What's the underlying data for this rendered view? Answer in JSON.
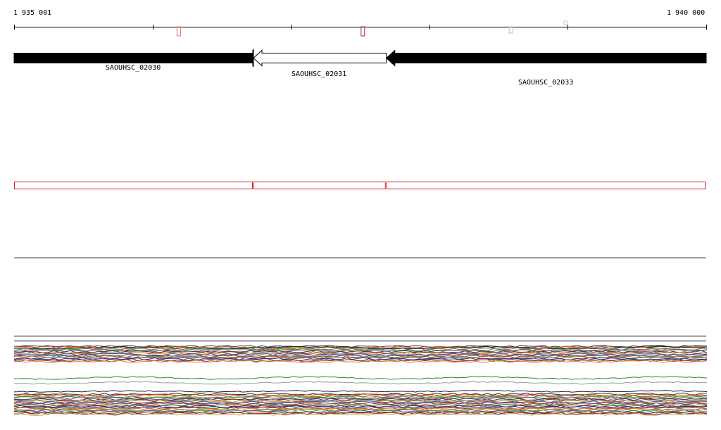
{
  "ruler": {
    "start_label": "1 935 001",
    "end_label": "1 940 000",
    "start": 1935001,
    "end": 1940000
  },
  "genes": [
    {
      "id": "SAOUHSC_02030",
      "start": 1935001,
      "end": 1936730,
      "strand": "+",
      "style": "filled"
    },
    {
      "id": "SAOUHSC_02031",
      "start": 1936730,
      "end": 1937690,
      "strand": "-",
      "style": "outline"
    },
    {
      "id": "SAOUHSC_02033",
      "start": 1937690,
      "end": 1940000,
      "strand": "-",
      "style": "filled"
    }
  ],
  "colors": {
    "gene_fill": "#000000",
    "feature_outline": "#cc2222",
    "ruler": "#000000"
  },
  "ruler_marks": [
    {
      "pos": 1936190,
      "color": "#e07060",
      "height": "tall"
    },
    {
      "pos": 1937520,
      "color": "#b82020",
      "height": "tall"
    },
    {
      "pos": 1938590,
      "color": "#f0b0a0",
      "height": "short"
    },
    {
      "pos": 1938985,
      "color": "#f0c0b0",
      "height": "tiny"
    }
  ]
}
